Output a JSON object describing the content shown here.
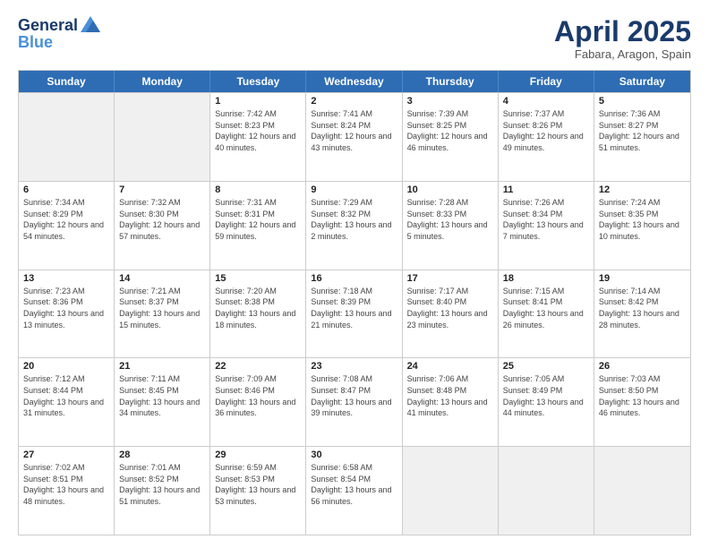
{
  "header": {
    "logo_general": "General",
    "logo_blue": "Blue",
    "month_title": "April 2025",
    "location": "Fabara, Aragon, Spain"
  },
  "weekdays": [
    "Sunday",
    "Monday",
    "Tuesday",
    "Wednesday",
    "Thursday",
    "Friday",
    "Saturday"
  ],
  "rows": [
    [
      {
        "day": "",
        "sunrise": "",
        "sunset": "",
        "daylight": "",
        "empty": true
      },
      {
        "day": "",
        "sunrise": "",
        "sunset": "",
        "daylight": "",
        "empty": true
      },
      {
        "day": "1",
        "sunrise": "Sunrise: 7:42 AM",
        "sunset": "Sunset: 8:23 PM",
        "daylight": "Daylight: 12 hours and 40 minutes.",
        "empty": false
      },
      {
        "day": "2",
        "sunrise": "Sunrise: 7:41 AM",
        "sunset": "Sunset: 8:24 PM",
        "daylight": "Daylight: 12 hours and 43 minutes.",
        "empty": false
      },
      {
        "day": "3",
        "sunrise": "Sunrise: 7:39 AM",
        "sunset": "Sunset: 8:25 PM",
        "daylight": "Daylight: 12 hours and 46 minutes.",
        "empty": false
      },
      {
        "day": "4",
        "sunrise": "Sunrise: 7:37 AM",
        "sunset": "Sunset: 8:26 PM",
        "daylight": "Daylight: 12 hours and 49 minutes.",
        "empty": false
      },
      {
        "day": "5",
        "sunrise": "Sunrise: 7:36 AM",
        "sunset": "Sunset: 8:27 PM",
        "daylight": "Daylight: 12 hours and 51 minutes.",
        "empty": false
      }
    ],
    [
      {
        "day": "6",
        "sunrise": "Sunrise: 7:34 AM",
        "sunset": "Sunset: 8:29 PM",
        "daylight": "Daylight: 12 hours and 54 minutes.",
        "empty": false
      },
      {
        "day": "7",
        "sunrise": "Sunrise: 7:32 AM",
        "sunset": "Sunset: 8:30 PM",
        "daylight": "Daylight: 12 hours and 57 minutes.",
        "empty": false
      },
      {
        "day": "8",
        "sunrise": "Sunrise: 7:31 AM",
        "sunset": "Sunset: 8:31 PM",
        "daylight": "Daylight: 12 hours and 59 minutes.",
        "empty": false
      },
      {
        "day": "9",
        "sunrise": "Sunrise: 7:29 AM",
        "sunset": "Sunset: 8:32 PM",
        "daylight": "Daylight: 13 hours and 2 minutes.",
        "empty": false
      },
      {
        "day": "10",
        "sunrise": "Sunrise: 7:28 AM",
        "sunset": "Sunset: 8:33 PM",
        "daylight": "Daylight: 13 hours and 5 minutes.",
        "empty": false
      },
      {
        "day": "11",
        "sunrise": "Sunrise: 7:26 AM",
        "sunset": "Sunset: 8:34 PM",
        "daylight": "Daylight: 13 hours and 7 minutes.",
        "empty": false
      },
      {
        "day": "12",
        "sunrise": "Sunrise: 7:24 AM",
        "sunset": "Sunset: 8:35 PM",
        "daylight": "Daylight: 13 hours and 10 minutes.",
        "empty": false
      }
    ],
    [
      {
        "day": "13",
        "sunrise": "Sunrise: 7:23 AM",
        "sunset": "Sunset: 8:36 PM",
        "daylight": "Daylight: 13 hours and 13 minutes.",
        "empty": false
      },
      {
        "day": "14",
        "sunrise": "Sunrise: 7:21 AM",
        "sunset": "Sunset: 8:37 PM",
        "daylight": "Daylight: 13 hours and 15 minutes.",
        "empty": false
      },
      {
        "day": "15",
        "sunrise": "Sunrise: 7:20 AM",
        "sunset": "Sunset: 8:38 PM",
        "daylight": "Daylight: 13 hours and 18 minutes.",
        "empty": false
      },
      {
        "day": "16",
        "sunrise": "Sunrise: 7:18 AM",
        "sunset": "Sunset: 8:39 PM",
        "daylight": "Daylight: 13 hours and 21 minutes.",
        "empty": false
      },
      {
        "day": "17",
        "sunrise": "Sunrise: 7:17 AM",
        "sunset": "Sunset: 8:40 PM",
        "daylight": "Daylight: 13 hours and 23 minutes.",
        "empty": false
      },
      {
        "day": "18",
        "sunrise": "Sunrise: 7:15 AM",
        "sunset": "Sunset: 8:41 PM",
        "daylight": "Daylight: 13 hours and 26 minutes.",
        "empty": false
      },
      {
        "day": "19",
        "sunrise": "Sunrise: 7:14 AM",
        "sunset": "Sunset: 8:42 PM",
        "daylight": "Daylight: 13 hours and 28 minutes.",
        "empty": false
      }
    ],
    [
      {
        "day": "20",
        "sunrise": "Sunrise: 7:12 AM",
        "sunset": "Sunset: 8:44 PM",
        "daylight": "Daylight: 13 hours and 31 minutes.",
        "empty": false
      },
      {
        "day": "21",
        "sunrise": "Sunrise: 7:11 AM",
        "sunset": "Sunset: 8:45 PM",
        "daylight": "Daylight: 13 hours and 34 minutes.",
        "empty": false
      },
      {
        "day": "22",
        "sunrise": "Sunrise: 7:09 AM",
        "sunset": "Sunset: 8:46 PM",
        "daylight": "Daylight: 13 hours and 36 minutes.",
        "empty": false
      },
      {
        "day": "23",
        "sunrise": "Sunrise: 7:08 AM",
        "sunset": "Sunset: 8:47 PM",
        "daylight": "Daylight: 13 hours and 39 minutes.",
        "empty": false
      },
      {
        "day": "24",
        "sunrise": "Sunrise: 7:06 AM",
        "sunset": "Sunset: 8:48 PM",
        "daylight": "Daylight: 13 hours and 41 minutes.",
        "empty": false
      },
      {
        "day": "25",
        "sunrise": "Sunrise: 7:05 AM",
        "sunset": "Sunset: 8:49 PM",
        "daylight": "Daylight: 13 hours and 44 minutes.",
        "empty": false
      },
      {
        "day": "26",
        "sunrise": "Sunrise: 7:03 AM",
        "sunset": "Sunset: 8:50 PM",
        "daylight": "Daylight: 13 hours and 46 minutes.",
        "empty": false
      }
    ],
    [
      {
        "day": "27",
        "sunrise": "Sunrise: 7:02 AM",
        "sunset": "Sunset: 8:51 PM",
        "daylight": "Daylight: 13 hours and 48 minutes.",
        "empty": false
      },
      {
        "day": "28",
        "sunrise": "Sunrise: 7:01 AM",
        "sunset": "Sunset: 8:52 PM",
        "daylight": "Daylight: 13 hours and 51 minutes.",
        "empty": false
      },
      {
        "day": "29",
        "sunrise": "Sunrise: 6:59 AM",
        "sunset": "Sunset: 8:53 PM",
        "daylight": "Daylight: 13 hours and 53 minutes.",
        "empty": false
      },
      {
        "day": "30",
        "sunrise": "Sunrise: 6:58 AM",
        "sunset": "Sunset: 8:54 PM",
        "daylight": "Daylight: 13 hours and 56 minutes.",
        "empty": false
      },
      {
        "day": "",
        "sunrise": "",
        "sunset": "",
        "daylight": "",
        "empty": true
      },
      {
        "day": "",
        "sunrise": "",
        "sunset": "",
        "daylight": "",
        "empty": true
      },
      {
        "day": "",
        "sunrise": "",
        "sunset": "",
        "daylight": "",
        "empty": true
      }
    ]
  ]
}
